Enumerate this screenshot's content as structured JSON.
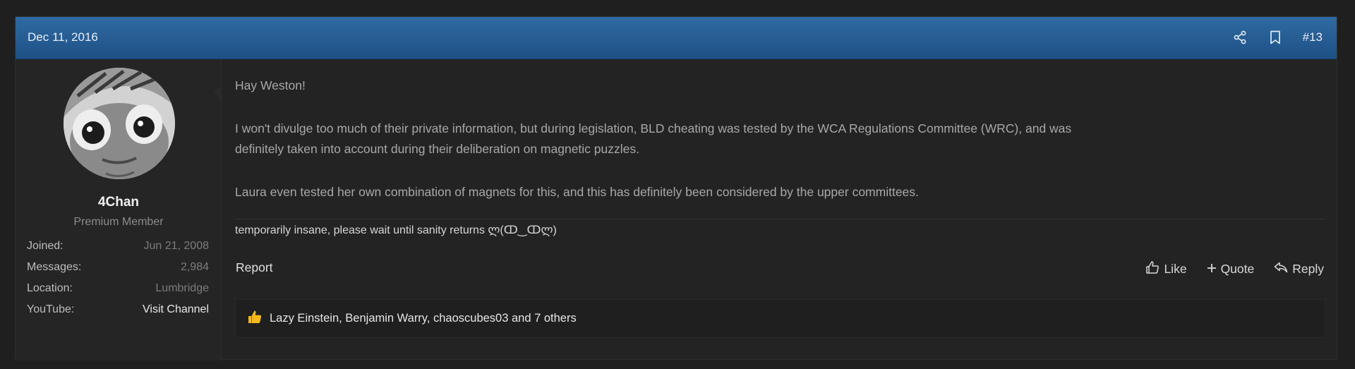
{
  "post": {
    "date": "Dec 11, 2016",
    "number": "#13",
    "header_icons": [
      "share-icon",
      "bookmark-icon"
    ]
  },
  "user": {
    "name": "4Chan",
    "title": "Premium Member",
    "stats": [
      {
        "label": "Joined:",
        "value": "Jun 21, 2008"
      },
      {
        "label": "Messages:",
        "value": "2,984"
      },
      {
        "label": "Location:",
        "value": "Lumbridge"
      },
      {
        "label": "YouTube:",
        "value": "Visit Channel"
      }
    ]
  },
  "message": {
    "greeting": "Hay Weston!",
    "paragraph1_line1": "I won't divulge too much of their private information, but during legislation, BLD cheating was tested by the WCA Regulations Committee (WRC), and was",
    "paragraph1_line2": "definitely taken into account during their deliberation on magnetic puzzles.",
    "paragraph2": "Laura even tested her own combination of magnets for this, and this has definitely been considered by the upper committees."
  },
  "signature": "temporarily insane, please wait until sanity returns ლ(ↀ‿ↀლ)",
  "actions": {
    "report": "Report",
    "like": "Like",
    "quote": "Quote",
    "reply": "Reply"
  },
  "reactions": {
    "text": "Lazy Einstein, Benjamin Warry, chaoscubes03 and 7 others",
    "icon": "thumbs-up-icon"
  },
  "colors": {
    "header_blue": "#2a5f94",
    "reaction_yellow": "#f5b818"
  }
}
